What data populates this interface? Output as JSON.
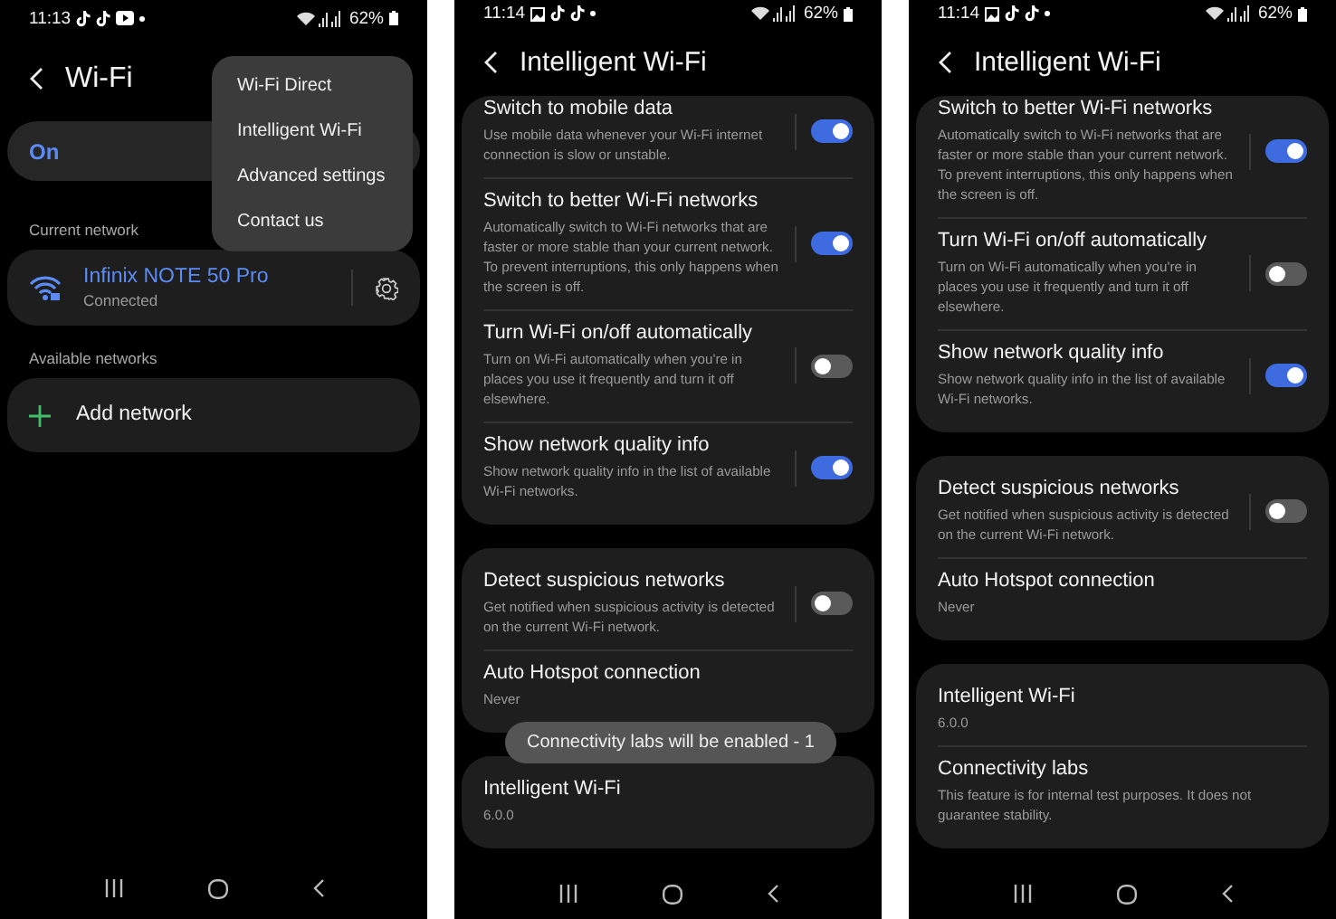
{
  "screens": [
    {
      "kind": "wifi",
      "status": {
        "time": "11:13",
        "battery": "62%"
      },
      "title": "Wi-Fi",
      "master": {
        "label": "On",
        "on": true
      },
      "current_header": "Current network",
      "current": {
        "name": "Infinix NOTE 50 Pro",
        "status": "Connected"
      },
      "available_header": "Available networks",
      "add": "Add network",
      "menu": [
        "Wi-Fi Direct",
        "Intelligent Wi-Fi",
        "Advanced settings",
        "Contact us"
      ]
    },
    {
      "kind": "settings",
      "status": {
        "time": "11:14",
        "battery": "62%"
      },
      "title": "Intelligent Wi-Fi",
      "groups": [
        [
          {
            "title": "Switch to mobile data",
            "desc": "Use mobile data whenever your Wi-Fi internet connection is slow or unstable.",
            "on": true
          },
          {
            "title": "Switch to better Wi-Fi networks",
            "desc": "Automatically switch to Wi-Fi networks that are faster or more stable than your current network. To prevent interruptions, this only happens when the screen is off.",
            "on": true
          },
          {
            "title": "Turn Wi-Fi on/off automatically",
            "desc": "Turn on Wi-Fi automatically when you're in places you use it frequently and turn it off elsewhere.",
            "on": false
          },
          {
            "title": "Show network quality info",
            "desc": "Show network quality info in the list of available Wi-Fi networks.",
            "on": true
          }
        ],
        [
          {
            "title": "Detect suspicious networks",
            "desc": "Get notified when suspicious activity is detected on the current Wi-Fi network.",
            "on": false
          },
          {
            "title": "Auto Hotspot connection",
            "desc": "Never"
          }
        ],
        [
          {
            "title": "Intelligent Wi-Fi",
            "desc": "6.0.0"
          }
        ]
      ],
      "toast": "Connectivity labs will be enabled - 1"
    },
    {
      "kind": "settings",
      "status": {
        "time": "11:14",
        "battery": "62%"
      },
      "title": "Intelligent Wi-Fi",
      "groups": [
        [
          {
            "title": "Switch to better Wi-Fi networks",
            "desc": "Automatically switch to Wi-Fi networks that are faster or more stable than your current network. To prevent interruptions, this only happens when the screen is off.",
            "on": true
          },
          {
            "title": "Turn Wi-Fi on/off automatically",
            "desc": "Turn on Wi-Fi automatically when you're in places you use it frequently and turn it off elsewhere.",
            "on": false
          },
          {
            "title": "Show network quality info",
            "desc": "Show network quality info in the list of available Wi-Fi networks.",
            "on": true
          }
        ],
        [
          {
            "title": "Detect suspicious networks",
            "desc": "Get notified when suspicious activity is detected on the current Wi-Fi network.",
            "on": false
          },
          {
            "title": "Auto Hotspot connection",
            "desc": "Never"
          }
        ],
        [
          {
            "title": "Intelligent Wi-Fi",
            "desc": "6.0.0"
          },
          {
            "title": "Connectivity labs",
            "desc": "This feature is for internal test purposes. It does not guarantee stability."
          }
        ]
      ]
    }
  ]
}
